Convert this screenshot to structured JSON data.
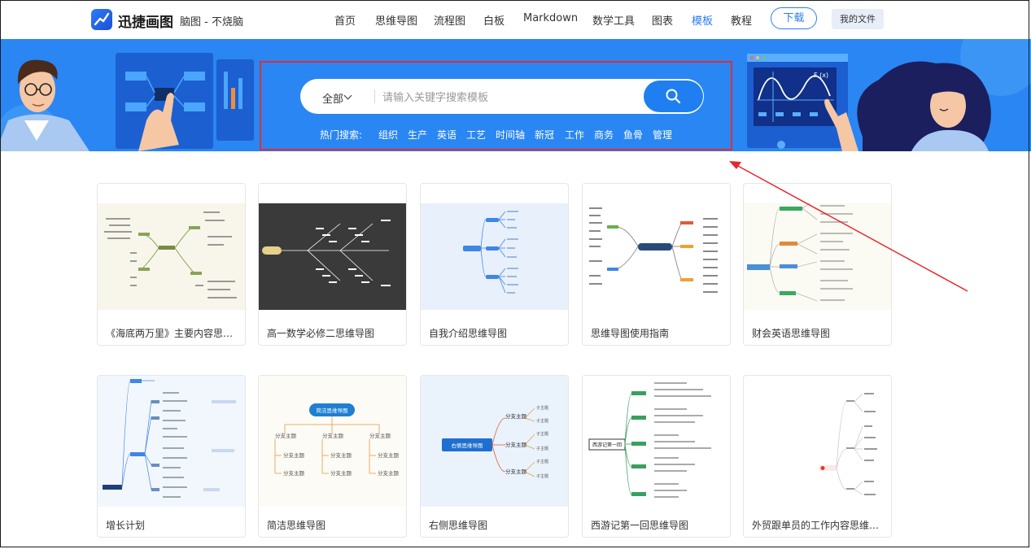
{
  "header": {
    "brand": "迅捷画图",
    "slogan": "脑图 - 不烧脑",
    "nav": [
      "首页",
      "思维导图",
      "流程图",
      "白板",
      "Markdown",
      "数学工具",
      "图表",
      "模板",
      "教程"
    ],
    "active_nav": "模板",
    "download_label": "下载",
    "my_files_label": "我的文件"
  },
  "banner": {
    "search": {
      "scope_label": "全部",
      "placeholder": "请输入关键字搜索模板",
      "value": ""
    },
    "hot_label": "热门搜索:",
    "hot_terms": [
      "组织",
      "生产",
      "英语",
      "工艺",
      "时间轴",
      "新冠",
      "工作",
      "商务",
      "鱼骨",
      "管理"
    ],
    "graph_label": "F (x)"
  },
  "templates_row1": [
    {
      "title": "《海底两万里》主要内容思维导图"
    },
    {
      "title": "高一数学必修二思维导图"
    },
    {
      "title": "自我介绍思维导图"
    },
    {
      "title": "思维导图使用指南"
    },
    {
      "title": "财会英语思维导图"
    }
  ],
  "templates_row2": [
    {
      "title": "增长计划"
    },
    {
      "title": "简洁思维导图"
    },
    {
      "title": "右侧思维导图"
    },
    {
      "title": "西游记第一回思维导图"
    },
    {
      "title": "外贸跟单员的工作内容思维导图"
    }
  ],
  "thumb_text": {
    "jianjie_center": "简洁思维导图",
    "jianjie_branch": "分支主题",
    "right_center": "右侧思维导图",
    "right_branch": "分支主题",
    "right_leaf": "子主题",
    "xiyou_center": "西游记第一回"
  },
  "colors": {
    "accent": "#2a7cf6",
    "banner_bg": "#2a86f2",
    "highlight_box": "#d9303a",
    "annotation_arrow": "#e5262b"
  }
}
